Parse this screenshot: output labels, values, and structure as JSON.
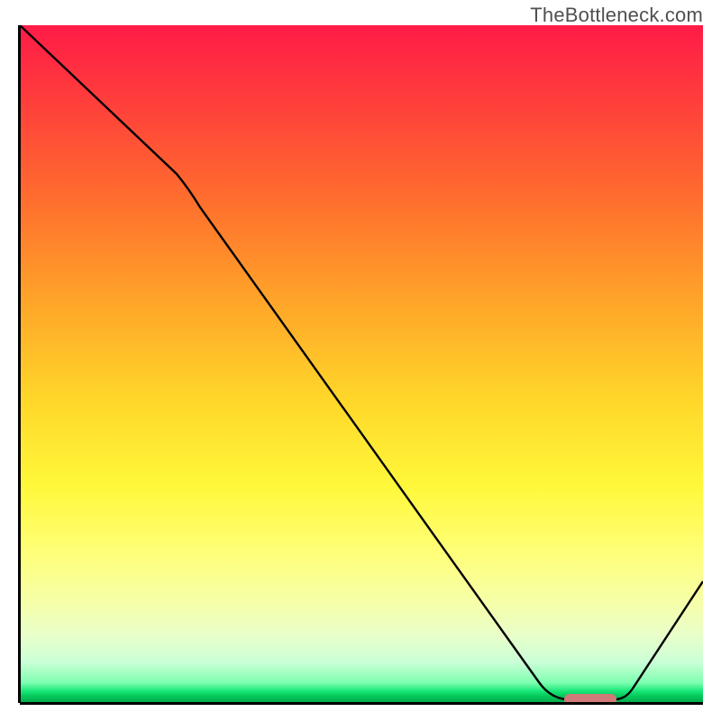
{
  "watermark": "TheBottleneck.com",
  "chart_data": {
    "type": "line",
    "title": "",
    "xlabel": "",
    "ylabel": "",
    "xlim": [
      0,
      100
    ],
    "ylim": [
      0,
      100
    ],
    "grid": false,
    "legend": false,
    "series": [
      {
        "name": "bottleneck-curve",
        "x": [
          0,
          23,
          76,
          80,
          87,
          100
        ],
        "values": [
          100,
          78,
          3,
          0.5,
          0.5,
          18
        ]
      }
    ],
    "annotations": [
      {
        "name": "optimal-marker",
        "shape": "pill",
        "x_range": [
          80,
          87
        ],
        "y": 0.5,
        "color": "#d17a7a"
      }
    ],
    "background_gradient": {
      "direction": "vertical",
      "stops": [
        {
          "pos": 0.0,
          "color": "#ff1b47"
        },
        {
          "pos": 0.25,
          "color": "#ff6b2e"
        },
        {
          "pos": 0.55,
          "color": "#ffd629"
        },
        {
          "pos": 0.78,
          "color": "#ffff7a"
        },
        {
          "pos": 0.97,
          "color": "#7effb0"
        },
        {
          "pos": 1.0,
          "color": "#04a74b"
        }
      ]
    }
  }
}
